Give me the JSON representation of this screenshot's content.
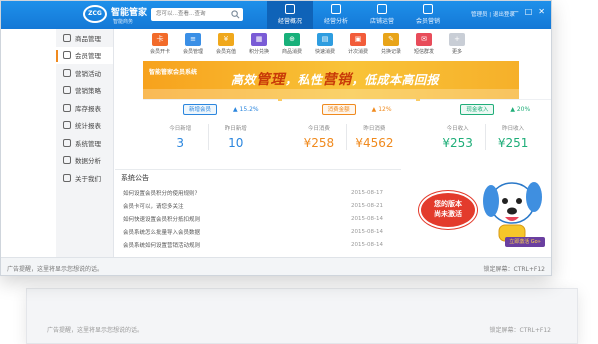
{
  "app": {
    "title": "智能管家",
    "subtitle": "智能商务",
    "logo_text": "ZCG",
    "search_placeholder": "您可以…查看…查询",
    "user": "管理员 | 退出登录"
  },
  "nav": {
    "tabs": [
      {
        "label": "经营概况",
        "active": true
      },
      {
        "label": "经营分析",
        "active": false
      },
      {
        "label": "店铺运营",
        "active": false
      },
      {
        "label": "会员营销",
        "active": false
      }
    ],
    "window_controls": [
      "—",
      "□",
      "✕"
    ]
  },
  "sidebar": {
    "items": [
      {
        "label": "商品管理",
        "icon": "box-icon",
        "active": false
      },
      {
        "label": "会员管理",
        "icon": "user-icon",
        "active": true
      },
      {
        "label": "营销活动",
        "icon": "gift-icon",
        "active": false
      },
      {
        "label": "营销策略",
        "icon": "target-icon",
        "active": false
      },
      {
        "label": "库存报表",
        "icon": "stock-icon",
        "active": false
      },
      {
        "label": "统计报表",
        "icon": "chart-icon",
        "active": false
      },
      {
        "label": "系统管理",
        "icon": "gear-icon",
        "active": false
      },
      {
        "label": "数据分析",
        "icon": "analysis-icon",
        "active": false
      },
      {
        "label": "关于我们",
        "icon": "info-icon",
        "active": false
      }
    ]
  },
  "toolbar": {
    "tools": [
      {
        "label": "会员开卡",
        "color": "#f26b2a",
        "glyph": "卡"
      },
      {
        "label": "会员管理",
        "color": "#3a8fe6",
        "glyph": "≡"
      },
      {
        "label": "会员充值",
        "color": "#f0a81c",
        "glyph": "¥"
      },
      {
        "label": "积分兑换",
        "color": "#7a5cd6",
        "glyph": "▦"
      },
      {
        "label": "商品消费",
        "color": "#18b07a",
        "glyph": "⊕"
      },
      {
        "label": "快速消费",
        "color": "#2e9de0",
        "glyph": "▤"
      },
      {
        "label": "计次消费",
        "color": "#f25c3a",
        "glyph": "▣"
      },
      {
        "label": "兑换记录",
        "color": "#e8a419",
        "glyph": "✎"
      },
      {
        "label": "短信群发",
        "color": "#e84c5a",
        "glyph": "✉"
      },
      {
        "label": "更多",
        "color": "#c9ced6",
        "glyph": "+"
      }
    ]
  },
  "banner": {
    "small": "智能管家会员系统",
    "main_before": "高效",
    "main_b1": "管理",
    "main_mid": "，私性",
    "main_b2": "营销",
    "main_after": "，低成本高回报"
  },
  "stats": [
    {
      "pill": "新增会员",
      "pill_color": "#2b86de",
      "trend": "▲ 15.2%",
      "trend_color": "#2b86de",
      "labels": [
        "今日新增",
        "昨日新增"
      ],
      "values": [
        "3",
        "10"
      ],
      "value_color": "#2b86de"
    },
    {
      "pill": "消费金额",
      "pill_color": "#f08a1e",
      "trend": "▲ 12%",
      "trend_color": "#f08a1e",
      "labels": [
        "今日消费",
        "昨日消费"
      ],
      "values": [
        "¥258",
        "¥4562"
      ],
      "value_color": "#f08a1e"
    },
    {
      "pill": "现金收入",
      "pill_color": "#1fae79",
      "trend": "▲ 20%",
      "trend_color": "#1fae79",
      "labels": [
        "今日收入",
        "昨日收入"
      ],
      "values": [
        "¥253",
        "¥251"
      ],
      "value_color": "#1fae79"
    }
  ],
  "notice": {
    "title": "系统公告",
    "rows": [
      {
        "text": "如何设置会员积分的使用规则？",
        "date": "2015-08-17"
      },
      {
        "text": "会员卡可以，请您多关注",
        "date": "2015-08-21"
      },
      {
        "text": "如何快速设置会员积分抵扣规则",
        "date": "2015-08-14"
      },
      {
        "text": "会员系统怎么批量导入会员数据",
        "date": "2015-08-14"
      },
      {
        "text": "会员系统如何设置营销活动规则",
        "date": "2015-08-14"
      }
    ]
  },
  "promo": {
    "bubble_line1": "您的版本",
    "bubble_line2": "尚未激活",
    "upgrade": "立即激活 Go»"
  },
  "statusbar": {
    "left": "广告提醒，这里将显示您想说的话。",
    "right": "锁定屏幕：CTRL+F12"
  }
}
